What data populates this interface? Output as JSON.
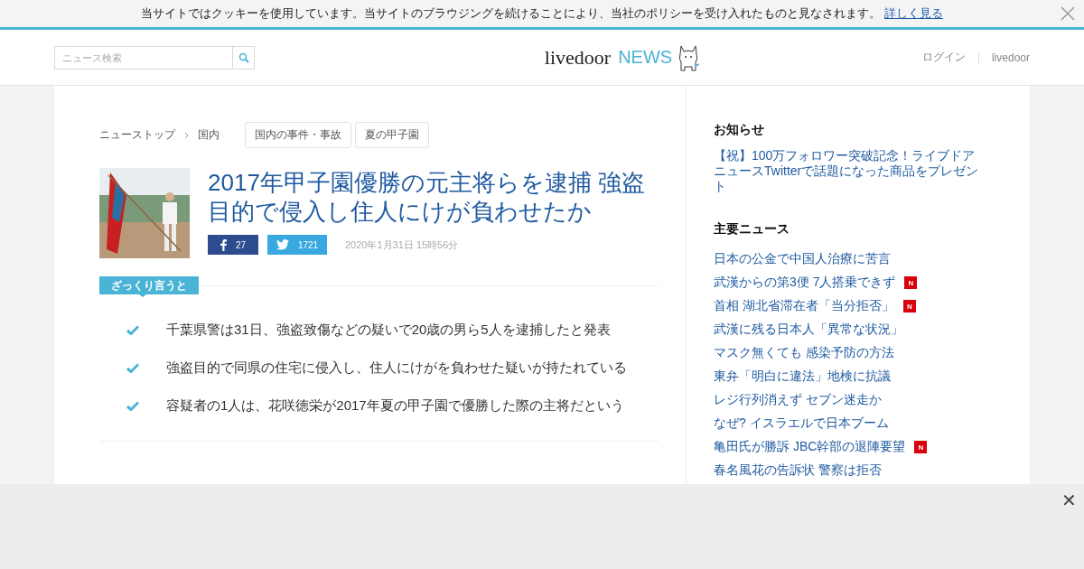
{
  "cookie_bar": {
    "text": "当サイトではクッキーを使用しています。当サイトのブラウジングを続けることにより、当社のポリシーを受け入れたものと見なされます。",
    "link": "詳しく見る"
  },
  "header": {
    "search": {
      "placeholder": "ニュース検索"
    },
    "logo": {
      "brand": "livedoor",
      "section": "NEWS"
    },
    "links": [
      "ログイン",
      "livedoor"
    ]
  },
  "breadcrumb": [
    "ニューストップ",
    "国内"
  ],
  "tags": [
    "国内の事件・事故",
    "夏の甲子園"
  ],
  "article": {
    "title": "2017年甲子園優勝の元主将らを逮捕 強盗目的で侵入し住人にけが負わせたか",
    "facebook_count": "27",
    "twitter_count": "1721",
    "date": "2020年1月31日 15時56分",
    "summary_label": "ざっくり言うと",
    "summary": [
      "千葉県警は31日、強盗致傷などの疑いで20歳の男ら5人を逮捕したと発表",
      "強盗目的で同県の住宅に侵入し、住人にけがを負わせた疑いが持たれている",
      "容疑者の1人は、花咲徳栄が2017年夏の甲子園で優勝した際の主将だという"
    ]
  },
  "sidebar": {
    "notice_title": "お知らせ",
    "notice": "【祝】100万フォロワー突破記念！ライブドアニュースTwitterで話題になった商品をプレゼント",
    "news_title": "主要ニュース",
    "news": [
      {
        "text": "日本の公金で中国人治療に苦言",
        "new": false
      },
      {
        "text": "武漢からの第3便 7人搭乗できず",
        "new": true,
        "badge": "N"
      },
      {
        "text": "首相 湖北省滞在者「当分拒否」",
        "new": true,
        "badge": "N"
      },
      {
        "text": "武漢に残る日本人「異常な状況」",
        "new": false
      },
      {
        "text": "マスク無くても 感染予防の方法",
        "new": false
      },
      {
        "text": "東弁「明白に違法」地検に抗議",
        "new": false
      },
      {
        "text": "レジ行列消えず セブン迷走か",
        "new": false
      },
      {
        "text": "なぜ? イスラエルで日本ブーム",
        "new": false
      },
      {
        "text": "亀田氏が勝訴 JBC幹部の退陣要望",
        "new": true,
        "badge": "N"
      },
      {
        "text": "春名風花の告訴状 警察は拒否",
        "new": false
      }
    ]
  },
  "ad_overlay": {
    "close": "✕"
  }
}
